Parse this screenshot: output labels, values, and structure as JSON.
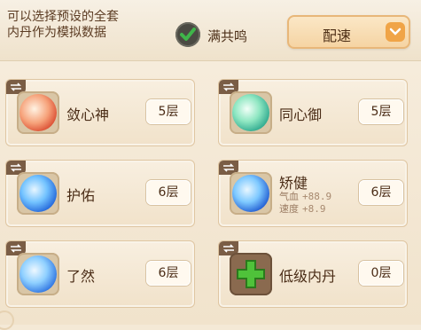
{
  "header": {
    "hint_line1": "可以选择预设的全套",
    "hint_line2": "内丹作为模拟数据",
    "checkbox_label": "满共鸣",
    "checkbox_checked": true,
    "dropdown_value": "配速"
  },
  "cards": [
    {
      "name": "敛心神",
      "layer": "5层",
      "icon": "fire-spirit-orb"
    },
    {
      "name": "同心御",
      "layer": "5层",
      "icon": "jade-shield-orb"
    },
    {
      "name": "护佑",
      "layer": "6层",
      "icon": "blue-guardian-orb"
    },
    {
      "name": "矫健",
      "layer": "6层",
      "icon": "water-drop-orb",
      "stat1_label": "气血",
      "stat1_value": "+88.9",
      "stat2_label": "速度",
      "stat2_value": "+8.9"
    },
    {
      "name": "了然",
      "layer": "6层",
      "icon": "blue-sage-orb"
    },
    {
      "name": "低级内丹",
      "layer": "0层",
      "icon": "green-plus-icon"
    }
  ],
  "colors": {
    "accent_orange": "#f0a447",
    "check_green": "#3fb54a"
  }
}
